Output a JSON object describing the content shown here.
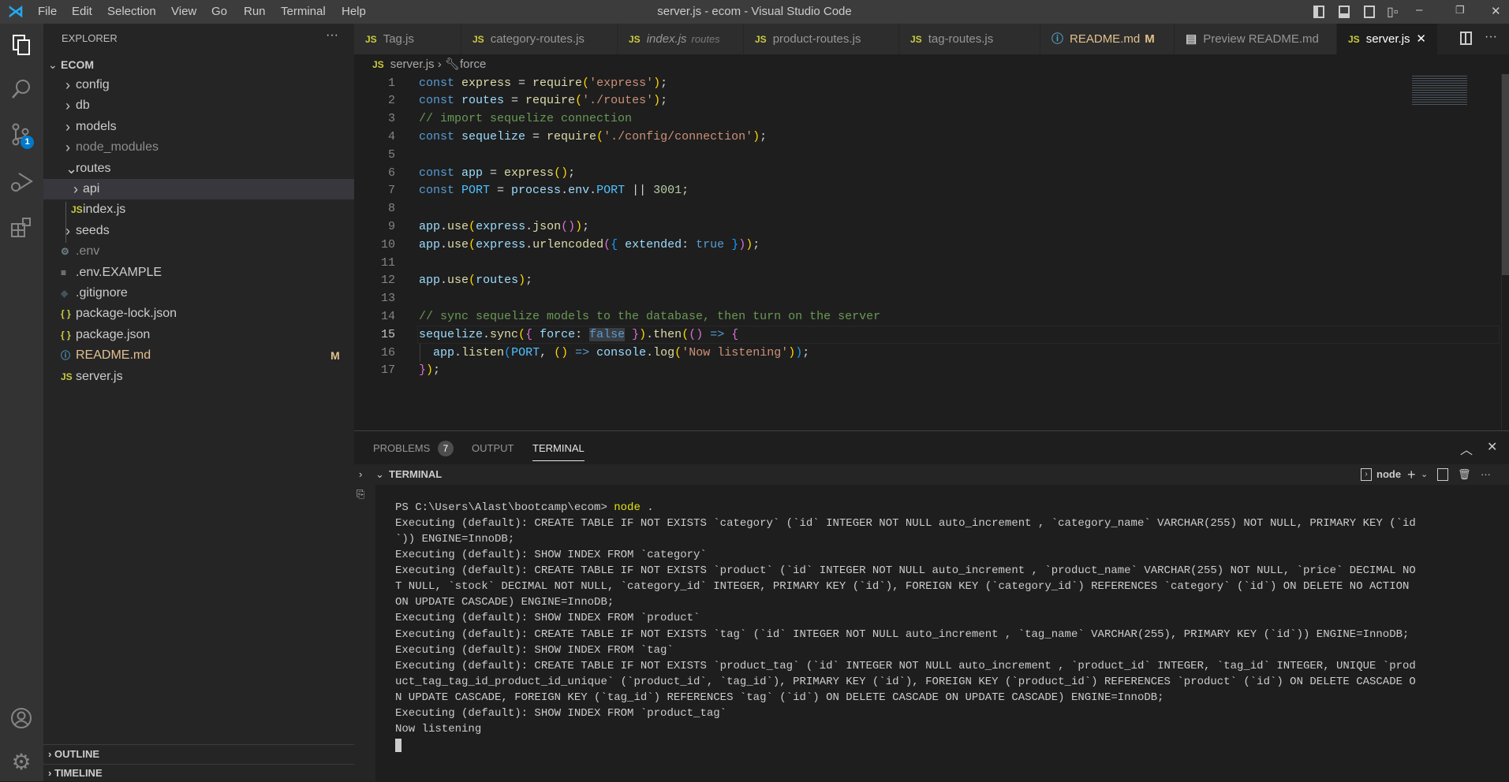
{
  "window": {
    "title": "server.js - ecom - Visual Studio Code",
    "menu": [
      "File",
      "Edit",
      "Selection",
      "View",
      "Go",
      "Run",
      "Terminal",
      "Help"
    ]
  },
  "activity": {
    "scm_badge": "1"
  },
  "sidebar": {
    "header": "EXPLORER",
    "more": "···",
    "root": "ECOM",
    "items": [
      {
        "label": "config",
        "type": "folder"
      },
      {
        "label": "db",
        "type": "folder"
      },
      {
        "label": "models",
        "type": "folder"
      },
      {
        "label": "node_modules",
        "type": "folder"
      },
      {
        "label": "routes",
        "type": "folder-open"
      },
      {
        "label": "api",
        "type": "folder"
      },
      {
        "label": "index.js",
        "type": "js"
      },
      {
        "label": "seeds",
        "type": "folder"
      },
      {
        "label": ".env",
        "type": "env"
      },
      {
        "label": ".env.EXAMPLE",
        "type": "text"
      },
      {
        "label": ".gitignore",
        "type": "git"
      },
      {
        "label": "package-lock.json",
        "type": "json"
      },
      {
        "label": "package.json",
        "type": "json"
      },
      {
        "label": "README.md",
        "type": "info",
        "badge": "M"
      },
      {
        "label": "server.js",
        "type": "js"
      }
    ],
    "outline": "OUTLINE",
    "timeline": "TIMELINE"
  },
  "tabs": [
    {
      "label": "Tag.js",
      "icon": "JS"
    },
    {
      "label": "category-routes.js",
      "icon": "JS"
    },
    {
      "label": "index.js",
      "desc": "routes",
      "icon": "JS"
    },
    {
      "label": "product-routes.js",
      "icon": "JS"
    },
    {
      "label": "tag-routes.js",
      "icon": "JS"
    },
    {
      "label": "README.md",
      "badge": "M",
      "icon": "ⓘ"
    },
    {
      "label": "Preview README.md",
      "icon": "▤"
    },
    {
      "label": "server.js",
      "icon": "JS",
      "active": true
    }
  ],
  "breadcrumb": {
    "file": "server.js",
    "symbol": "force"
  },
  "editor": {
    "current_line": 15,
    "lines": [
      [
        [
          "const ",
          "k"
        ],
        [
          "express",
          "f"
        ],
        [
          " = ",
          "p"
        ],
        [
          "require",
          "f"
        ],
        [
          "(",
          "b1"
        ],
        [
          "'express'",
          "s"
        ],
        [
          ")",
          "b1"
        ],
        [
          ";",
          "p"
        ]
      ],
      [
        [
          "const ",
          "k"
        ],
        [
          "routes",
          "v"
        ],
        [
          " = ",
          "p"
        ],
        [
          "require",
          "f"
        ],
        [
          "(",
          "b1"
        ],
        [
          "'./routes'",
          "s"
        ],
        [
          ")",
          "b1"
        ],
        [
          ";",
          "p"
        ]
      ],
      [
        [
          "// import sequelize connection",
          "c"
        ]
      ],
      [
        [
          "const ",
          "k"
        ],
        [
          "sequelize",
          "v"
        ],
        [
          " = ",
          "p"
        ],
        [
          "require",
          "f"
        ],
        [
          "(",
          "b1"
        ],
        [
          "'./config/connection'",
          "s"
        ],
        [
          ")",
          "b1"
        ],
        [
          ";",
          "p"
        ]
      ],
      [],
      [
        [
          "const ",
          "k"
        ],
        [
          "app",
          "v"
        ],
        [
          " = ",
          "p"
        ],
        [
          "express",
          "f"
        ],
        [
          "()",
          "b1"
        ],
        [
          ";",
          "p"
        ]
      ],
      [
        [
          "const ",
          "k"
        ],
        [
          "PORT",
          "o"
        ],
        [
          " = ",
          "p"
        ],
        [
          "process",
          "v"
        ],
        [
          ".",
          "p"
        ],
        [
          "env",
          "v"
        ],
        [
          ".",
          "p"
        ],
        [
          "PORT",
          "o"
        ],
        [
          " || ",
          "p"
        ],
        [
          "3001",
          "n"
        ],
        [
          ";",
          "p"
        ]
      ],
      [],
      [
        [
          "app",
          "v"
        ],
        [
          ".",
          "p"
        ],
        [
          "use",
          "f"
        ],
        [
          "(",
          "b1"
        ],
        [
          "express",
          "v"
        ],
        [
          ".",
          "p"
        ],
        [
          "json",
          "f"
        ],
        [
          "()",
          "b2"
        ],
        [
          ")",
          "b1"
        ],
        [
          ";",
          "p"
        ]
      ],
      [
        [
          "app",
          "v"
        ],
        [
          ".",
          "p"
        ],
        [
          "use",
          "f"
        ],
        [
          "(",
          "b1"
        ],
        [
          "express",
          "v"
        ],
        [
          ".",
          "p"
        ],
        [
          "urlencoded",
          "f"
        ],
        [
          "(",
          "b2"
        ],
        [
          "{ ",
          "b3"
        ],
        [
          "extended",
          "v"
        ],
        [
          ": ",
          "p"
        ],
        [
          "true",
          "k"
        ],
        [
          " }",
          "b3"
        ],
        [
          ")",
          "b2"
        ],
        [
          ")",
          "b1"
        ],
        [
          ";",
          "p"
        ]
      ],
      [],
      [
        [
          "app",
          "v"
        ],
        [
          ".",
          "p"
        ],
        [
          "use",
          "f"
        ],
        [
          "(",
          "b1"
        ],
        [
          "routes",
          "v"
        ],
        [
          ")",
          "b1"
        ],
        [
          ";",
          "p"
        ]
      ],
      [],
      [
        [
          "// sync sequelize models to the database, then turn on the server",
          "c"
        ]
      ],
      [
        [
          "sequelize",
          "v"
        ],
        [
          ".",
          "p"
        ],
        [
          "sync",
          "f"
        ],
        [
          "(",
          "b1"
        ],
        [
          "{ ",
          "b2"
        ],
        [
          "force",
          "v"
        ],
        [
          ": ",
          "p"
        ],
        [
          "false",
          "k sel"
        ],
        [
          " }",
          "b2"
        ],
        [
          ")",
          "b1"
        ],
        [
          ".",
          "p"
        ],
        [
          "then",
          "f"
        ],
        [
          "(",
          "b1"
        ],
        [
          "()",
          "b2"
        ],
        [
          " => ",
          "k"
        ],
        [
          "{",
          "b2"
        ]
      ],
      [
        [
          "  app",
          "v"
        ],
        [
          ".",
          "p"
        ],
        [
          "listen",
          "f"
        ],
        [
          "(",
          "b3"
        ],
        [
          "PORT",
          "o"
        ],
        [
          ", ",
          "p"
        ],
        [
          "()",
          "b1"
        ],
        [
          " => ",
          "k"
        ],
        [
          "console",
          "v"
        ],
        [
          ".",
          "p"
        ],
        [
          "log",
          "f"
        ],
        [
          "(",
          "b1"
        ],
        [
          "'Now listening'",
          "s"
        ],
        [
          ")",
          "b1"
        ],
        [
          ")",
          "b3"
        ],
        [
          ";",
          "p"
        ]
      ],
      [
        [
          "}",
          "b2"
        ],
        [
          ")",
          "b1"
        ],
        [
          ";",
          "p"
        ]
      ]
    ]
  },
  "panel": {
    "tabs": [
      {
        "label": "PROBLEMS",
        "count": "7"
      },
      {
        "label": "OUTPUT"
      },
      {
        "label": "TERMINAL",
        "active": true
      }
    ],
    "terminal_header": "TERMINAL",
    "shell": "node",
    "lines": [
      "PS C:\\Users\\Alast\\bootcamp\\ecom> node .",
      "Executing (default): CREATE TABLE IF NOT EXISTS `category` (`id` INTEGER NOT NULL auto_increment , `category_name` VARCHAR(255) NOT NULL, PRIMARY KEY (`id",
      "`)) ENGINE=InnoDB;",
      "Executing (default): SHOW INDEX FROM `category`",
      "Executing (default): CREATE TABLE IF NOT EXISTS `product` (`id` INTEGER NOT NULL auto_increment , `product_name` VARCHAR(255) NOT NULL, `price` DECIMAL NO",
      "T NULL, `stock` DECIMAL NOT NULL, `category_id` INTEGER, PRIMARY KEY (`id`), FOREIGN KEY (`category_id`) REFERENCES `category` (`id`) ON DELETE NO ACTION",
      "ON UPDATE CASCADE) ENGINE=InnoDB;",
      "Executing (default): SHOW INDEX FROM `product`",
      "Executing (default): CREATE TABLE IF NOT EXISTS `tag` (`id` INTEGER NOT NULL auto_increment , `tag_name` VARCHAR(255), PRIMARY KEY (`id`)) ENGINE=InnoDB;",
      "Executing (default): SHOW INDEX FROM `tag`",
      "Executing (default): CREATE TABLE IF NOT EXISTS `product_tag` (`id` INTEGER NOT NULL auto_increment , `product_id` INTEGER, `tag_id` INTEGER, UNIQUE `prod",
      "uct_tag_tag_id_product_id_unique` (`product_id`, `tag_id`), PRIMARY KEY (`id`), FOREIGN KEY (`product_id`) REFERENCES `product` (`id`) ON DELETE CASCADE O",
      "N UPDATE CASCADE, FOREIGN KEY (`tag_id`) REFERENCES `tag` (`id`) ON DELETE CASCADE ON UPDATE CASCADE) ENGINE=InnoDB;",
      "Executing (default): SHOW INDEX FROM `product_tag`",
      "Now listening"
    ]
  }
}
